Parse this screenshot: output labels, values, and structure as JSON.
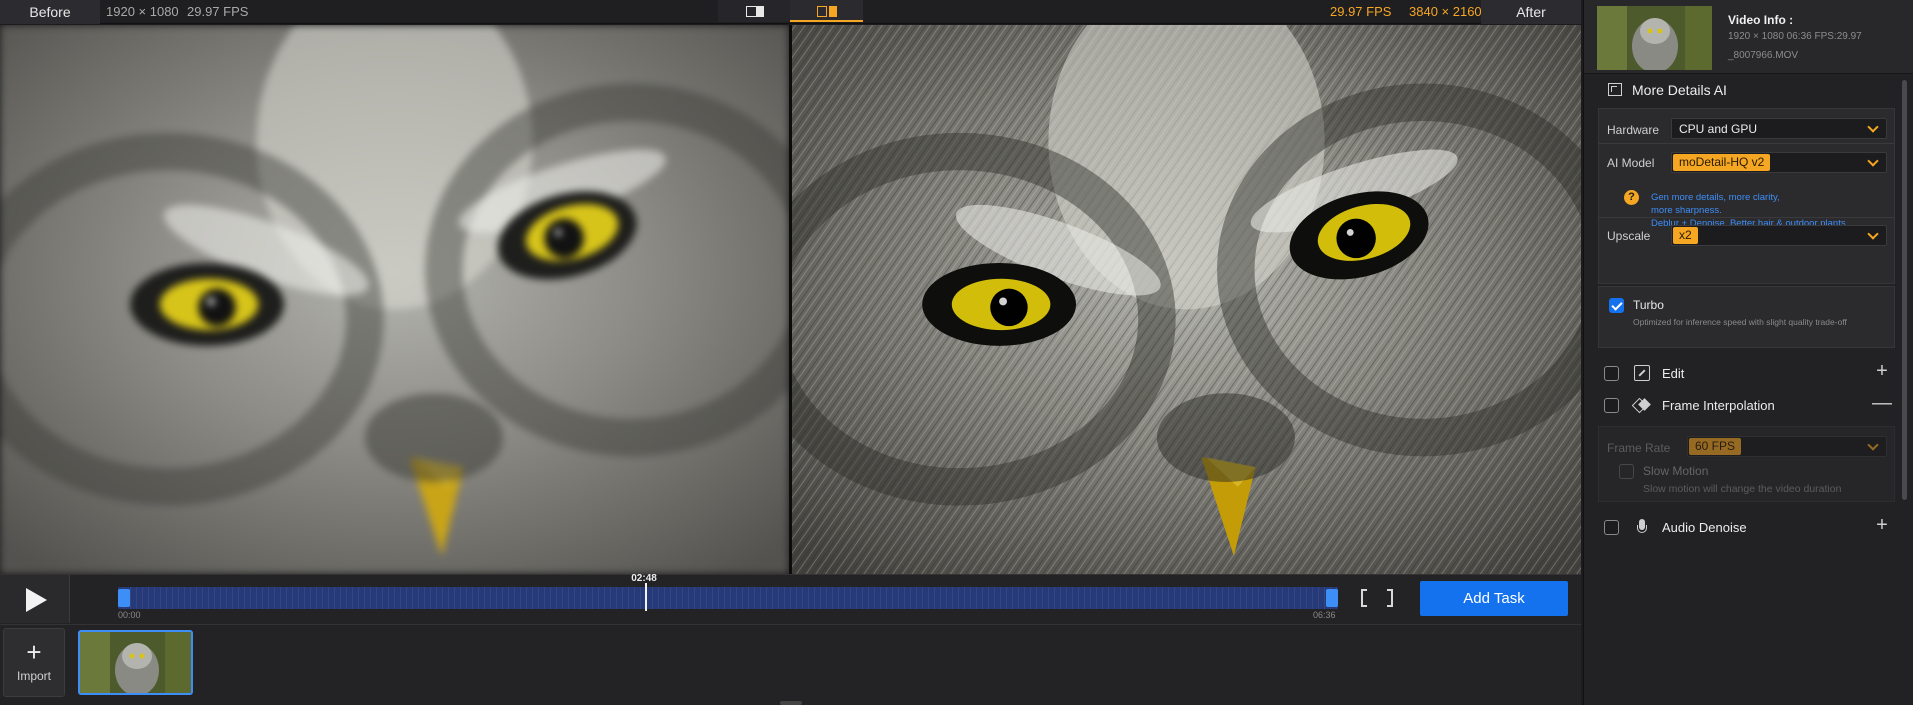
{
  "topbar": {
    "before_label": "Before",
    "before_resolution": "1920 × 1080",
    "before_fps": "29.97 FPS",
    "after_fps": "29.97 FPS",
    "after_resolution": "3840 × 2160",
    "after_label": "After",
    "view_mode": "split",
    "accent_color": "#f5a623"
  },
  "timeline": {
    "current_time": "02:48",
    "start_time": "00:00",
    "end_time": "06:36",
    "progress": 0.433,
    "add_task_label": "Add Task"
  },
  "import_strip": {
    "import_label": "Import"
  },
  "video_info": {
    "title": "Video Info :",
    "meta": "1920 × 1080 06:36 FPS:29.97",
    "filename": "_8007966.MOV"
  },
  "more_details": {
    "title": "More Details AI",
    "hardware_label": "Hardware",
    "hardware_value": "CPU and GPU",
    "model_label": "AI Model",
    "model_value": "moDetail-HQ  v2",
    "model_desc_1": "Gen more details, more clarity,",
    "model_desc_2": "more sharpness.",
    "model_desc_3": "Deblur + Denoise. Better hair & outdoor plants.",
    "upscale_label": "Upscale",
    "upscale_value": "x2",
    "turbo_label": "Turbo",
    "turbo_checked": true,
    "turbo_desc": "Optimized for inference speed with slight quality trade-off"
  },
  "sections": {
    "edit": {
      "title": "Edit",
      "toggle": "+"
    },
    "frame": {
      "title": "Frame Interpolation",
      "toggle": "—"
    },
    "audio": {
      "title": "Audio Denoise",
      "toggle": "+"
    }
  },
  "frame_interpolation": {
    "rate_label": "Frame Rate",
    "rate_value": "60 FPS",
    "slow_label": "Slow Motion",
    "slow_desc": "Slow motion will change the video duration"
  }
}
